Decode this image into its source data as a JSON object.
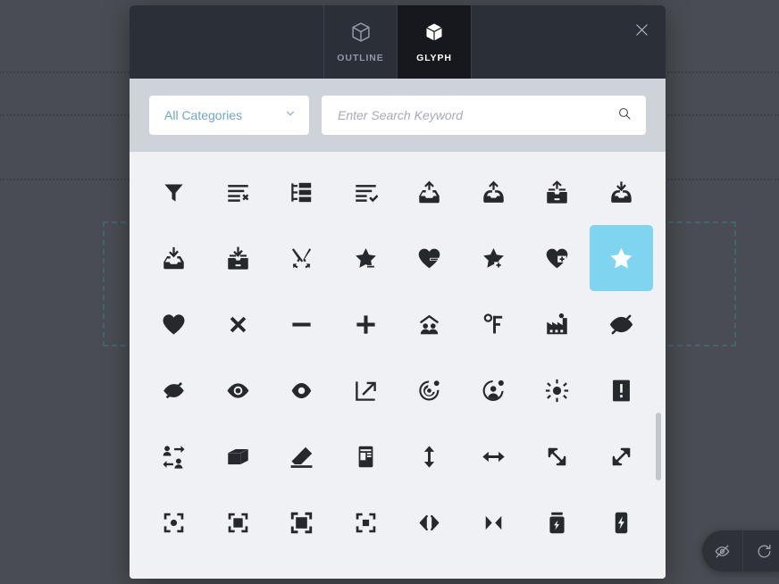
{
  "background": {
    "overlay_color": "#494d53",
    "guide_line_color": "#3c4046",
    "selection_box_color": "#44656e"
  },
  "float_toolbar": {
    "buttons": [
      {
        "name": "hide-preview-icon",
        "icon": "eye-slash"
      },
      {
        "name": "reset-icon",
        "icon": "refresh"
      }
    ]
  },
  "modal": {
    "accent_selected": "#7fd4ef",
    "header": {
      "tabs": [
        {
          "label": "OUTLINE",
          "icon": "cube-outline",
          "active": false
        },
        {
          "label": "GLYPH",
          "icon": "cube-solid",
          "active": true
        }
      ],
      "close_label": "Close"
    },
    "search": {
      "category_value": "All Categories",
      "category_icon": "chevron-down-icon",
      "search_value": "",
      "search_placeholder": "Enter Search Keyword",
      "search_icon": "search-icon"
    },
    "grid": {
      "columns": 8,
      "selected_index": 15,
      "icons": [
        {
          "name": "filter-icon"
        },
        {
          "name": "list-remove-icon"
        },
        {
          "name": "list-tree-icon"
        },
        {
          "name": "list-check-icon"
        },
        {
          "name": "inbox-upload-rounded-icon"
        },
        {
          "name": "inbox-upload-curved-icon"
        },
        {
          "name": "inbox-upload-flat-icon"
        },
        {
          "name": "inbox-download-curved-icon"
        },
        {
          "name": "inbox-download-rounded-icon"
        },
        {
          "name": "inbox-download-flat-icon"
        },
        {
          "name": "scissors-icon"
        },
        {
          "name": "star-minus-icon"
        },
        {
          "name": "heart-minus-icon"
        },
        {
          "name": "star-plus-icon"
        },
        {
          "name": "heart-plus-icon"
        },
        {
          "name": "star-icon"
        },
        {
          "name": "heart-icon"
        },
        {
          "name": "close-x-icon"
        },
        {
          "name": "minus-icon"
        },
        {
          "name": "plus-icon"
        },
        {
          "name": "family-home-icon"
        },
        {
          "name": "fahrenheit-icon"
        },
        {
          "name": "factory-icon"
        },
        {
          "name": "eye-slash-outline-icon"
        },
        {
          "name": "eye-slash-solid-icon"
        },
        {
          "name": "eye-icon"
        },
        {
          "name": "eye-solid-icon"
        },
        {
          "name": "expand-arrow-icon"
        },
        {
          "name": "target-radar-icon"
        },
        {
          "name": "user-alert-icon"
        },
        {
          "name": "brightness-sun-icon"
        },
        {
          "name": "exclamation-box-icon"
        },
        {
          "name": "user-exchange-icon"
        },
        {
          "name": "box-3d-icon"
        },
        {
          "name": "eraser-icon"
        },
        {
          "name": "mobile-device-icon"
        },
        {
          "name": "arrows-vertical-icon"
        },
        {
          "name": "arrows-horizontal-icon"
        },
        {
          "name": "resize-diagonal-icon"
        },
        {
          "name": "expand-diagonal-icon"
        },
        {
          "name": "focus-dot-icon"
        },
        {
          "name": "focus-square-icon"
        },
        {
          "name": "fullscreen-icon"
        },
        {
          "name": "focus-small-icon"
        },
        {
          "name": "code-brackets-icon"
        },
        {
          "name": "arrows-collapse-icon"
        },
        {
          "name": "battery-charge-icon"
        },
        {
          "name": "battery-bolt-icon"
        }
      ]
    },
    "scrollbar": {
      "thumb_color": "#c3c7cd"
    }
  }
}
